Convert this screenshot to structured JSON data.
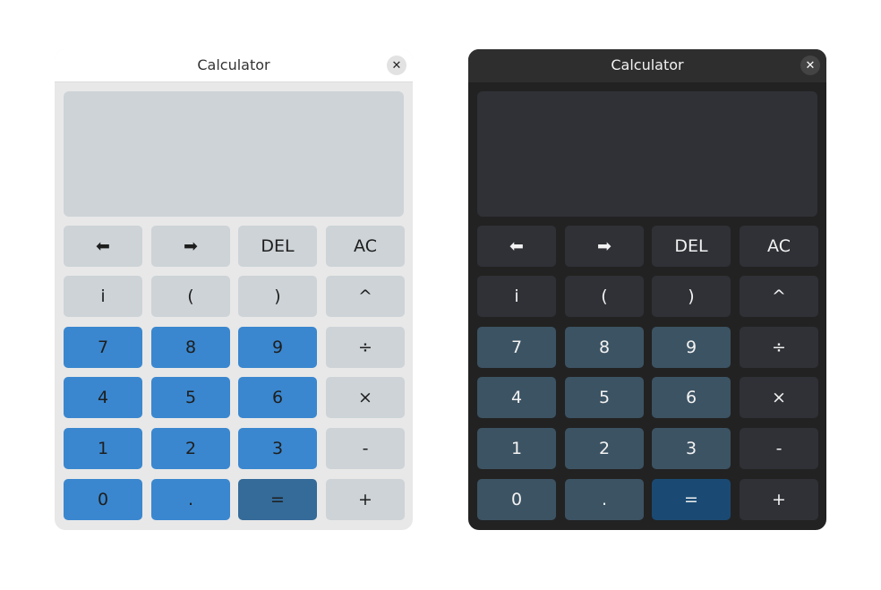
{
  "windows": [
    {
      "theme": "light",
      "title": "Calculator",
      "close_glyph": "✕",
      "display_text": "",
      "keys": {
        "left": "⬅",
        "right": "➡",
        "del": "DEL",
        "ac": "AC",
        "i": "i",
        "lparen": "(",
        "rparen": ")",
        "pow": "^",
        "seven": "7",
        "eight": "8",
        "nine": "9",
        "div": "÷",
        "four": "4",
        "five": "5",
        "six": "6",
        "mul": "×",
        "one": "1",
        "two": "2",
        "three": "3",
        "sub": "-",
        "zero": "0",
        "dot": ".",
        "eq": "=",
        "add": "+"
      }
    },
    {
      "theme": "dark",
      "title": "Calculator",
      "close_glyph": "✕",
      "display_text": "",
      "keys": {
        "left": "⬅",
        "right": "➡",
        "del": "DEL",
        "ac": "AC",
        "i": "i",
        "lparen": "(",
        "rparen": ")",
        "pow": "^",
        "seven": "7",
        "eight": "8",
        "nine": "9",
        "div": "÷",
        "four": "4",
        "five": "5",
        "six": "6",
        "mul": "×",
        "one": "1",
        "two": "2",
        "three": "3",
        "sub": "-",
        "zero": "0",
        "dot": ".",
        "eq": "=",
        "add": "+"
      }
    }
  ],
  "colors": {
    "light_window": "#e8e8e8",
    "light_display": "#cdd3d7",
    "light_number_key": "#3a87cf",
    "light_equals_key": "#346b99",
    "dark_window": "#222222",
    "dark_display": "#2f3136",
    "dark_number_key": "#3c5363",
    "dark_equals_key": "#1a4a73"
  }
}
